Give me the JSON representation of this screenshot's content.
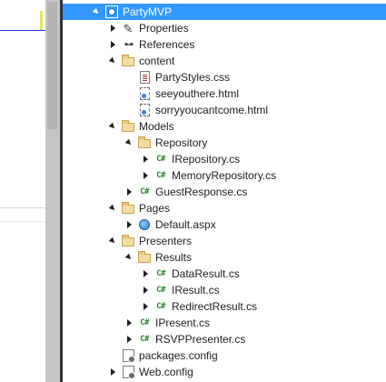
{
  "solution_explorer": {
    "items": [
      {
        "label": "PartyMVP",
        "icon": "web-project-icon",
        "expander": "expanded",
        "level": 0,
        "selected": true
      },
      {
        "label": "Properties",
        "icon": "wrench-icon",
        "expander": "collapsed",
        "level": 1
      },
      {
        "label": "References",
        "icon": "references-icon",
        "expander": "collapsed",
        "level": 1
      },
      {
        "label": "content",
        "icon": "folder-icon",
        "expander": "expanded",
        "level": 1
      },
      {
        "label": "PartyStyles.css",
        "icon": "css-file-icon",
        "expander": "none",
        "level": 2
      },
      {
        "label": "seeyouthere.html",
        "icon": "html-file-icon",
        "expander": "none",
        "level": 2
      },
      {
        "label": "sorryyoucantcome.html",
        "icon": "html-file-icon",
        "expander": "none",
        "level": 2
      },
      {
        "label": "Models",
        "icon": "folder-icon",
        "expander": "expanded",
        "level": 1
      },
      {
        "label": "Repository",
        "icon": "folder-icon",
        "expander": "expanded",
        "level": 2
      },
      {
        "label": "IRepository.cs",
        "icon": "csharp-file-icon",
        "expander": "collapsed",
        "level": 3
      },
      {
        "label": "MemoryRepository.cs",
        "icon": "csharp-file-icon",
        "expander": "collapsed",
        "level": 3
      },
      {
        "label": "GuestResponse.cs",
        "icon": "csharp-file-icon",
        "expander": "collapsed",
        "level": 2
      },
      {
        "label": "Pages",
        "icon": "folder-icon",
        "expander": "expanded",
        "level": 1
      },
      {
        "label": "Default.aspx",
        "icon": "web-form-icon",
        "expander": "collapsed",
        "level": 2
      },
      {
        "label": "Presenters",
        "icon": "folder-icon",
        "expander": "expanded",
        "level": 1
      },
      {
        "label": "Results",
        "icon": "folder-icon",
        "expander": "expanded",
        "level": 2
      },
      {
        "label": "DataResult.cs",
        "icon": "csharp-file-icon",
        "expander": "collapsed",
        "level": 3
      },
      {
        "label": "IResult.cs",
        "icon": "csharp-file-icon",
        "expander": "collapsed",
        "level": 3
      },
      {
        "label": "RedirectResult.cs",
        "icon": "csharp-file-icon",
        "expander": "collapsed",
        "level": 3
      },
      {
        "label": "IPresent.cs",
        "icon": "csharp-file-icon",
        "expander": "collapsed",
        "level": 2
      },
      {
        "label": "RSVPPresenter.cs",
        "icon": "csharp-file-icon",
        "expander": "collapsed",
        "level": 2
      },
      {
        "label": "packages.config",
        "icon": "config-file-icon",
        "expander": "none",
        "level": 1
      },
      {
        "label": "Web.config",
        "icon": "config-file-icon",
        "expander": "collapsed",
        "level": 1
      }
    ],
    "csharp_glyph": "C#",
    "colors": {
      "selection": "#3399ff",
      "csharp": "#2a8a2a",
      "folder": "#e8c77b"
    }
  }
}
